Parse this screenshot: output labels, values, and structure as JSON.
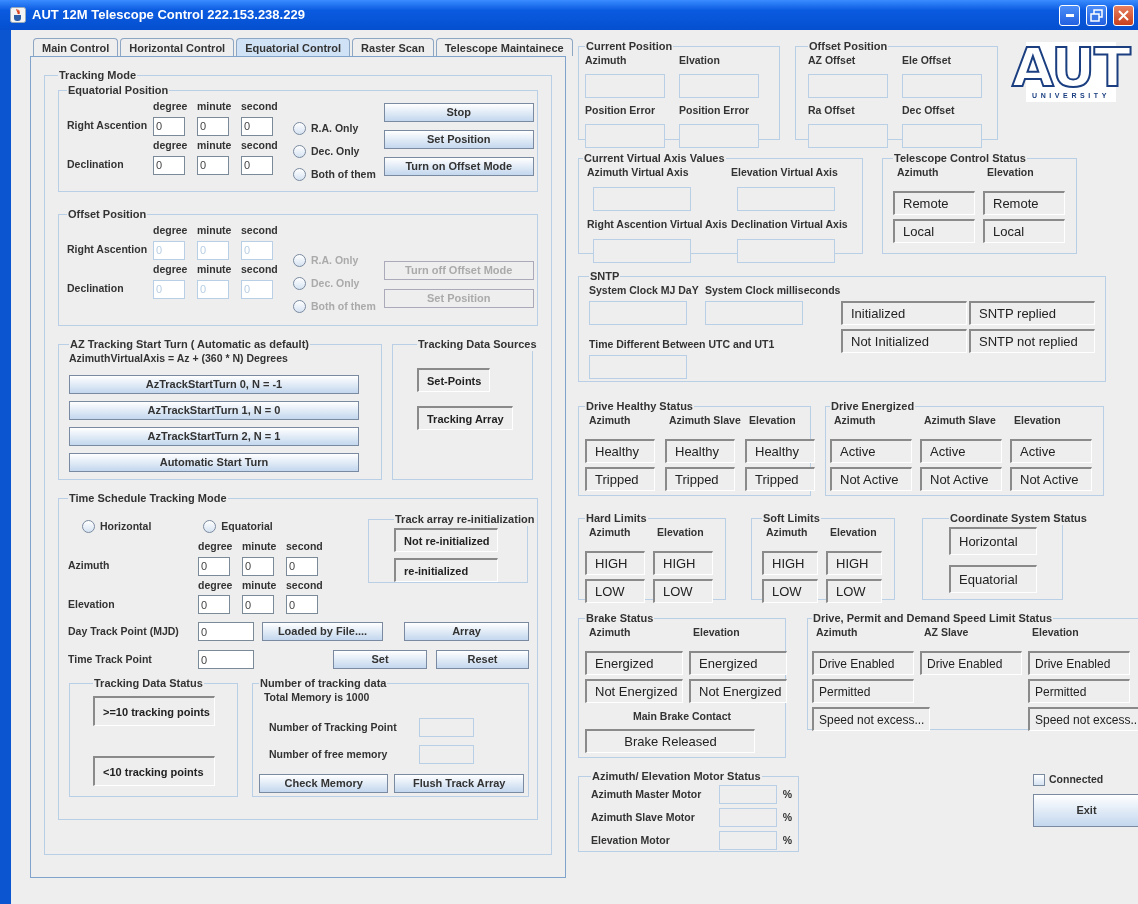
{
  "window": {
    "title": "AUT 12M Telescope Control 222.153.238.229"
  },
  "tabs": [
    {
      "label": "Main Control",
      "selected": false
    },
    {
      "label": "Horizontal Control",
      "selected": false
    },
    {
      "label": "Equatorial Control",
      "selected": true
    },
    {
      "label": "Raster Scan",
      "selected": false
    },
    {
      "label": "Telescope Maintainece",
      "selected": false
    }
  ],
  "tracking_mode": {
    "title": "Tracking Mode",
    "equatorial_position": {
      "title": "Equatorial Position",
      "disabled": false,
      "rows": [
        {
          "label": "Right Ascention",
          "units": [
            "degree",
            "minute",
            "second"
          ],
          "values": [
            "0",
            "0",
            "0"
          ]
        },
        {
          "label": "Declination",
          "units": [
            "degree",
            "minute",
            "second"
          ],
          "values": [
            "0",
            "0",
            "0"
          ]
        }
      ],
      "radios": [
        {
          "label": "R.A. Only",
          "selected": false
        },
        {
          "label": "Dec. Only",
          "selected": false
        },
        {
          "label": "Both of them",
          "selected": false
        }
      ],
      "buttons": [
        "Stop",
        "Set Position",
        "Turn on Offset Mode"
      ]
    },
    "offset_position": {
      "title": "Offset Position",
      "disabled": true,
      "rows": [
        {
          "label": "Right Ascention",
          "units": [
            "degree",
            "minute",
            "second"
          ],
          "values": [
            "0",
            "0",
            "0"
          ]
        },
        {
          "label": "Declination",
          "units": [
            "degree",
            "minute",
            "second"
          ],
          "values": [
            "0",
            "0",
            "0"
          ]
        }
      ],
      "radios": [
        {
          "label": "R.A. Only",
          "selected": false
        },
        {
          "label": "Dec. Only",
          "selected": false
        },
        {
          "label": "Both of them",
          "selected": false
        }
      ],
      "buttons": [
        "Turn off Offset Mode",
        "Set Position"
      ]
    },
    "az_start_turn": {
      "title": "AZ Tracking Start Turn ( Automatic as default)",
      "formula": "AzimuthVirtualAxis = Az + (360 * N) Degrees",
      "buttons": [
        "AzTrackStartTurn 0, N = -1",
        "AzTrackStartTurn 1, N = 0",
        "AzTrackStartTurn 2, N = 1",
        "Automatic Start Turn"
      ]
    },
    "tracking_data_sources": {
      "title": "Tracking Data Sources",
      "indicators": [
        "Set-Points",
        "Tracking Array"
      ]
    },
    "time_schedule": {
      "title": "Time Schedule Tracking Mode",
      "radios": [
        {
          "label": "Horizontal",
          "selected": false
        },
        {
          "label": "Equatorial",
          "selected": false
        }
      ],
      "rows": [
        {
          "label": "Azimuth",
          "units": [
            "degree",
            "minute",
            "second"
          ],
          "values": [
            "0",
            "0",
            "0"
          ]
        },
        {
          "label": "Elevation",
          "units": [
            "degree",
            "minute",
            "second"
          ],
          "values": [
            "0",
            "0",
            "0"
          ]
        }
      ],
      "reinit": {
        "title": "Track array re-initialization",
        "indicators": [
          "Not re-initialized",
          "re-initialized"
        ]
      },
      "day_track": {
        "label": "Day Track Point (MJD)",
        "value": "0",
        "buttons": [
          "Loaded by File....",
          "Array"
        ]
      },
      "time_track": {
        "label": "Time Track Point",
        "value": "0",
        "buttons": [
          "Set",
          "Reset"
        ]
      },
      "data_status": {
        "title": "Tracking Data Status",
        "indicators": [
          ">=10 tracking points",
          "<10 tracking points"
        ]
      },
      "memory": {
        "title": "Number of tracking data",
        "total": "Total Memory is 1000",
        "fields": [
          "Number of Tracking Point",
          "Number of free memory"
        ],
        "buttons": [
          "Check Memory",
          "Flush Track Array"
        ]
      }
    }
  },
  "current_position": {
    "title": "Current Position",
    "fields": [
      "Azimuth",
      "Elvation",
      "Position Error",
      "Position Error"
    ]
  },
  "offset_readout": {
    "title": "Offset Position",
    "fields": [
      "AZ Offset",
      "Ele Offset",
      "Ra Offset",
      "Dec Offset"
    ]
  },
  "logo": {
    "wordmark": "AUT",
    "subtitle": "UNIVERSITY"
  },
  "virtual_axis": {
    "title": "Current Virtual Axis Values",
    "fields": [
      "Azimuth Virtual Axis",
      "Elevation Virtual Axis",
      "Right Ascention Virtual Axis",
      "Declination Virtual Axis"
    ]
  },
  "control_status": {
    "title": "Telescope Control Status",
    "columns": [
      {
        "label": "Azimuth",
        "indicators": [
          "Remote",
          "Local"
        ]
      },
      {
        "label": "Elevation",
        "indicators": [
          "Remote",
          "Local"
        ]
      }
    ]
  },
  "sntp": {
    "title": "SNTP",
    "fields": [
      "System Clock MJ DaY",
      "System Clock milliseconds",
      "Time Different Between UTC and UT1"
    ],
    "indicators": [
      "Initialized",
      "SNTP replied",
      "Not Initialized",
      "SNTP not replied"
    ]
  },
  "drive_healthy": {
    "title": "Drive Healthy Status",
    "columns": [
      {
        "label": "Azimuth",
        "indicators": [
          "Healthy",
          "Tripped"
        ]
      },
      {
        "label": "Azimuth Slave",
        "indicators": [
          "Healthy",
          "Tripped"
        ]
      },
      {
        "label": "Elevation",
        "indicators": [
          "Healthy",
          "Tripped"
        ]
      }
    ]
  },
  "drive_energized": {
    "title": "Drive Energized",
    "columns": [
      {
        "label": "Azimuth",
        "indicators": [
          "Active",
          "Not Active"
        ]
      },
      {
        "label": "Azimuth Slave",
        "indicators": [
          "Active",
          "Not Active"
        ]
      },
      {
        "label": "Elevation",
        "indicators": [
          "Active",
          "Not Active"
        ]
      }
    ]
  },
  "hard_limits": {
    "title": "Hard Limits",
    "columns": [
      {
        "label": "Azimuth",
        "indicators": [
          "HIGH",
          "LOW"
        ]
      },
      {
        "label": "Elevation",
        "indicators": [
          "HIGH",
          "LOW"
        ]
      }
    ]
  },
  "soft_limits": {
    "title": "Soft Limits",
    "columns": [
      {
        "label": "Azimuth",
        "indicators": [
          "HIGH",
          "LOW"
        ]
      },
      {
        "label": "Elevation",
        "indicators": [
          "HIGH",
          "LOW"
        ]
      }
    ]
  },
  "coordinate_status": {
    "title": "Coordinate System Status",
    "indicators": [
      "Horizontal",
      "Equatorial"
    ]
  },
  "brake_status": {
    "title": "Brake Status",
    "columns": [
      {
        "label": "Azimuth",
        "indicators": [
          "Energized",
          "Not Energized"
        ]
      },
      {
        "label": "Elevation",
        "indicators": [
          "Energized",
          "Not Energized"
        ]
      }
    ],
    "main_label": "Main Brake Contact",
    "main_indicator": "Brake Released"
  },
  "drive_permit": {
    "title": "Drive, Permit and Demand Speed Limit Status",
    "columns": [
      {
        "label": "Azimuth",
        "indicators": [
          "Drive Enabled",
          "Permitted",
          "Speed not excess..."
        ]
      },
      {
        "label": "AZ Slave",
        "indicators": [
          "Drive Enabled"
        ]
      },
      {
        "label": "Elevation",
        "indicators": [
          "Drive Enabled",
          "Permitted",
          "Speed not excess.."
        ]
      }
    ]
  },
  "motor_status": {
    "title": "Azimuth/ Elevation Motor Status",
    "rows": [
      {
        "label": "Azimuth Master Motor",
        "unit": "%"
      },
      {
        "label": "Azimuth Slave Motor",
        "unit": "%"
      },
      {
        "label": "Elevation Motor",
        "unit": "%"
      }
    ]
  },
  "connected": {
    "label": "Connected",
    "checked": false
  },
  "exit_button": "Exit"
}
